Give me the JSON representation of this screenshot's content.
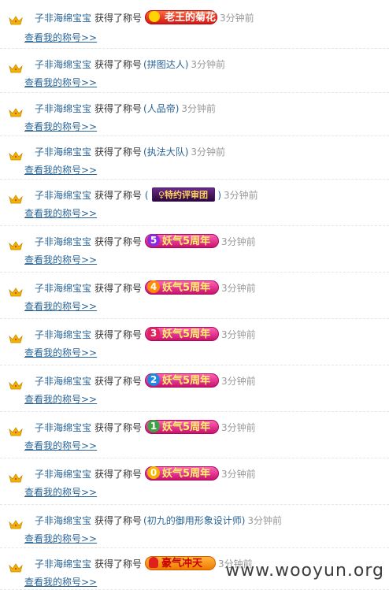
{
  "feed": {
    "items": [
      {
        "user": "子非海绵宝宝",
        "action": "获得了称号",
        "badge_type": "lao",
        "badge_text": "老王的菊花",
        "time": "3分钟前",
        "link": "查看我的称号>>"
      },
      {
        "user": "子非海绵宝宝",
        "action": "获得了称号",
        "title_text": "(拼图达人)",
        "time": "3分钟前",
        "link": "查看我的称号>>"
      },
      {
        "user": "子非海绵宝宝",
        "action": "获得了称号",
        "title_text": "(人品帝)",
        "time": "3分钟前",
        "link": "查看我的称号>>"
      },
      {
        "user": "子非海绵宝宝",
        "action": "获得了称号",
        "title_text": "(执法大队)",
        "time": "3分钟前",
        "link": "查看我的称号>>"
      },
      {
        "user": "子非海绵宝宝",
        "action": "获得了称号",
        "badge_type": "tyt",
        "badge_text": "♀特约评审团",
        "paren": true,
        "time": "3分钟前",
        "link": "查看我的称号>>"
      },
      {
        "user": "子非海绵宝宝",
        "action": "获得了称号",
        "badge_type": "yao",
        "badge_num": "5",
        "badge_text": "妖气5周年",
        "num_color": "#8a2be2",
        "time": "3分钟前",
        "link": "查看我的称号>>"
      },
      {
        "user": "子非海绵宝宝",
        "action": "获得了称号",
        "badge_type": "yao",
        "badge_num": "4",
        "badge_text": "妖气5周年",
        "num_color": "#ff8c00",
        "time": "3分钟前",
        "link": "查看我的称号>>"
      },
      {
        "user": "子非海绵宝宝",
        "action": "获得了称号",
        "badge_type": "yao",
        "badge_num": "3",
        "badge_text": "妖气5周年",
        "num_color": "#e0245e",
        "time": "3分钟前",
        "link": "查看我的称号>>"
      },
      {
        "user": "子非海绵宝宝",
        "action": "获得了称号",
        "badge_type": "yao",
        "badge_num": "2",
        "badge_text": "妖气5周年",
        "num_color": "#1e88e5",
        "time": "3分钟前",
        "link": "查看我的称号>>"
      },
      {
        "user": "子非海绵宝宝",
        "action": "获得了称号",
        "badge_type": "yao",
        "badge_num": "1",
        "badge_text": "妖气5周年",
        "num_color": "#43a047",
        "time": "3分钟前",
        "link": "查看我的称号>>"
      },
      {
        "user": "子非海绵宝宝",
        "action": "获得了称号",
        "badge_type": "yao",
        "badge_num": "0",
        "badge_text": "妖气5周年",
        "num_color": "#f4b400",
        "time": "3分钟前",
        "link": "查看我的称号>>"
      },
      {
        "user": "子非海绵宝宝",
        "action": "获得了称号",
        "title_text": "(初九的御用形象设计师)",
        "time": "3分钟前",
        "link": "查看我的称号>>"
      },
      {
        "user": "子非海绵宝宝",
        "action": "获得了称号",
        "badge_type": "hao",
        "badge_text": "豪气冲天",
        "time": "3分钟前",
        "link": "查看我的称号>>"
      }
    ]
  },
  "watermark": "www.wooyun.org",
  "colors": {
    "link": "#2a6496",
    "time": "#999999",
    "crown": "#e8a317"
  }
}
